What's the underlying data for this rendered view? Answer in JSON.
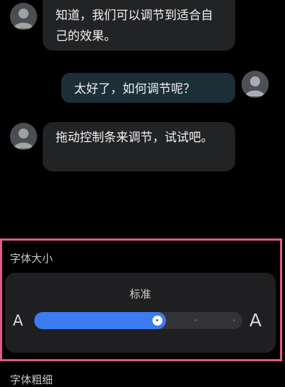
{
  "messages": [
    {
      "side": "incoming",
      "text": "知道，我们可以调节到适合自己的效果。"
    },
    {
      "side": "outgoing",
      "text": "太好了，如何调节呢？"
    },
    {
      "side": "incoming",
      "text": "拖动控制条来调节，试试吧。"
    }
  ],
  "font_size_section": {
    "label": "字体大小",
    "preset_name": "标准",
    "small_glyph": "A",
    "large_glyph": "A",
    "slider": {
      "steps": 6,
      "selected_step": 2
    }
  },
  "font_weight_section": {
    "label": "字体粗细"
  },
  "colors": {
    "accent": "#3d7bf2",
    "highlight_border": "#e05a89",
    "bubble_incoming": "#222325",
    "bubble_outgoing": "#1c2e36"
  },
  "icons": [
    "avatar-icon",
    "slider-thumb"
  ]
}
